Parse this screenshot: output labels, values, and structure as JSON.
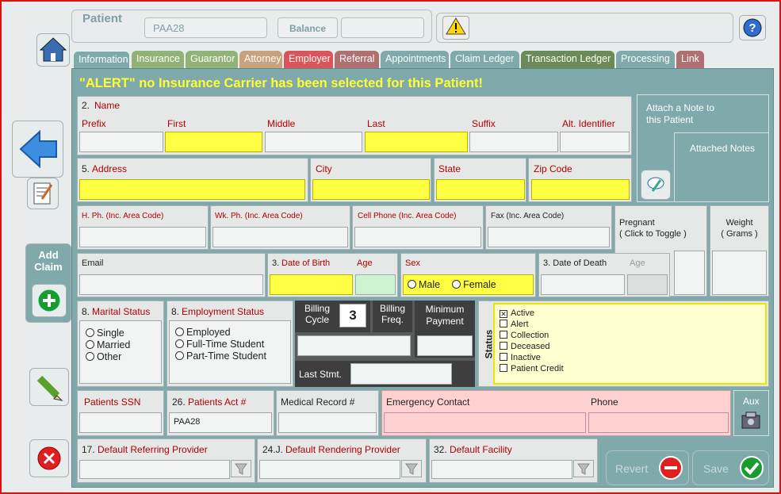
{
  "header": {
    "title": "Patient",
    "patient_id": "PAA28",
    "balance_label": "Balance"
  },
  "tabs": [
    "Information",
    "Insurance",
    "Guarantor",
    "Attorney",
    "Employer",
    "Referral",
    "Appointments",
    "Claim Ledger",
    "Transaction Ledger",
    "Processing",
    "Link"
  ],
  "alert": "\"ALERT\" no Insurance Carrier has been selected for this Patient!",
  "name": {
    "num": "2.",
    "title": "Name",
    "prefix": "Prefix",
    "first": "First",
    "middle": "Middle",
    "last": "Last",
    "suffix": "Suffix",
    "alt": "Alt. Identifier"
  },
  "notes": {
    "attach": "Attach a Note to this Patient",
    "attached": "Attached Notes"
  },
  "address": {
    "num": "5.",
    "title": "Address",
    "city": "City",
    "state": "State",
    "zip": "Zip Code"
  },
  "phones": {
    "home": "H. Ph. (Inc. Area Code)",
    "work": "Wk. Ph. (Inc. Area Code)",
    "cell": "Cell Phone (Inc. Area Code)",
    "fax": "Fax (Inc. Area Code)",
    "pregnant": "Pregnant\n( Click to Toggle )",
    "weight": "Weight\n( Grams )"
  },
  "row4": {
    "email": "Email",
    "dob_num": "3.",
    "dob": "Date of Birth",
    "age": "Age",
    "sex": "Sex",
    "male": "Male",
    "female": "Female",
    "dod": "3. Date of Death",
    "age2": "Age"
  },
  "marital": {
    "num": "8.",
    "title": "Marital Status",
    "options": [
      "Single",
      "Married",
      "Other"
    ]
  },
  "employment": {
    "num": "8.",
    "title": "Employment Status",
    "options": [
      "Employed",
      "Full-Time Student",
      "Part-Time Student"
    ]
  },
  "billing": {
    "cycle": "Billing Cycle",
    "cycle_value": "3",
    "freq": "Billing Freq.",
    "min": "Minimum Payment",
    "last": "Last Stmt."
  },
  "status": {
    "label": "Status",
    "items": [
      {
        "t": "Active",
        "c": true
      },
      {
        "t": "Alert",
        "c": false
      },
      {
        "t": "Collection",
        "c": false
      },
      {
        "t": "Deceased",
        "c": false
      },
      {
        "t": "Inactive",
        "c": false
      },
      {
        "t": "Patient Credit",
        "c": false
      }
    ]
  },
  "row6": {
    "ssn": "Patients SSN",
    "act_num": "26.",
    "act": "Patients Act #",
    "act_value": "PAA28",
    "mrn": "Medical Record #",
    "emergency": "Emergency Contact",
    "phone": "Phone",
    "aux": "Aux"
  },
  "row7": {
    "ref_num": "17.",
    "ref": "Default Referring Provider",
    "rend_num": "24.J.",
    "rend": "Default Rendering Provider",
    "fac_num": "32.",
    "fac": "Default Facility"
  },
  "buttons": {
    "revert": "Revert",
    "save": "Save",
    "add_claim": "Add Claim"
  },
  "colors": {
    "alert": "#ffff33",
    "panel": "#7fa9ab",
    "required": "#ffff44"
  }
}
